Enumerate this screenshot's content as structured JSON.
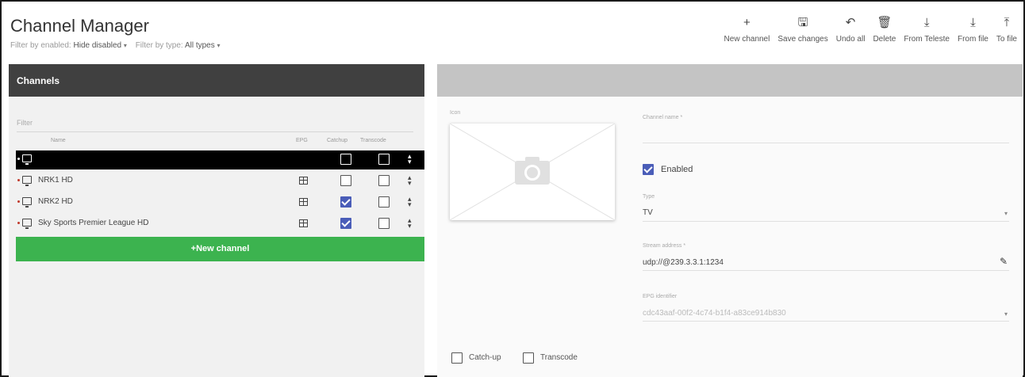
{
  "app": {
    "title": "Channel Manager"
  },
  "filters": {
    "enabled_label": "Filter by enabled:",
    "enabled_value": "Hide disabled",
    "type_label": "Filter by type:",
    "type_value": "All types"
  },
  "toolbar": [
    {
      "label": "New channel",
      "icon": "plus-icon",
      "glyph": "+"
    },
    {
      "label": "Save changes",
      "icon": "save-icon",
      "glyph": "🖫"
    },
    {
      "label": "Undo all",
      "icon": "undo-icon",
      "glyph": "↶"
    },
    {
      "label": "Delete",
      "icon": "trash-icon",
      "glyph": "🗑"
    },
    {
      "label": "From Teleste",
      "icon": "download-icon",
      "glyph": "⤓"
    },
    {
      "label": "From file",
      "icon": "download-icon",
      "glyph": "⤓"
    },
    {
      "label": "To file",
      "icon": "upload-icon",
      "glyph": "⤒"
    }
  ],
  "left": {
    "title": "Channels",
    "filter_placeholder": "Filter",
    "columns": {
      "name": "Name",
      "epg": "EPG",
      "catchup": "Catchup",
      "transcode": "Transcode"
    },
    "rows": [
      {
        "name": "",
        "selected": true,
        "catchup": false,
        "transcode": false,
        "epg": false
      },
      {
        "name": "NRK1 HD",
        "selected": false,
        "catchup": false,
        "transcode": false,
        "epg": true
      },
      {
        "name": "NRK2 HD",
        "selected": false,
        "catchup": true,
        "transcode": false,
        "epg": true
      },
      {
        "name": "Sky Sports Premier League HD",
        "selected": false,
        "catchup": true,
        "transcode": false,
        "epg": true
      }
    ],
    "new_channel_label": "New channel"
  },
  "detail": {
    "icon_label": "Icon",
    "channel_name_label": "Channel name *",
    "channel_name_value": "",
    "enabled_label": "Enabled",
    "enabled": true,
    "type_label": "Type",
    "type_value": "TV",
    "stream_label": "Stream address *",
    "stream_value": "udp://@239.3.3.1:1234",
    "epg_label": "EPG identifier",
    "epg_value": "cdc43aaf-00f2-4c74-b1f4-a83ce914b830",
    "catchup_label": "Catch-up",
    "transcode_label": "Transcode"
  },
  "colors": {
    "accent": "#4a5db8",
    "primary_button": "#3cb34f",
    "panel_header": "#404040",
    "detail_header": "#c4c4c4"
  }
}
